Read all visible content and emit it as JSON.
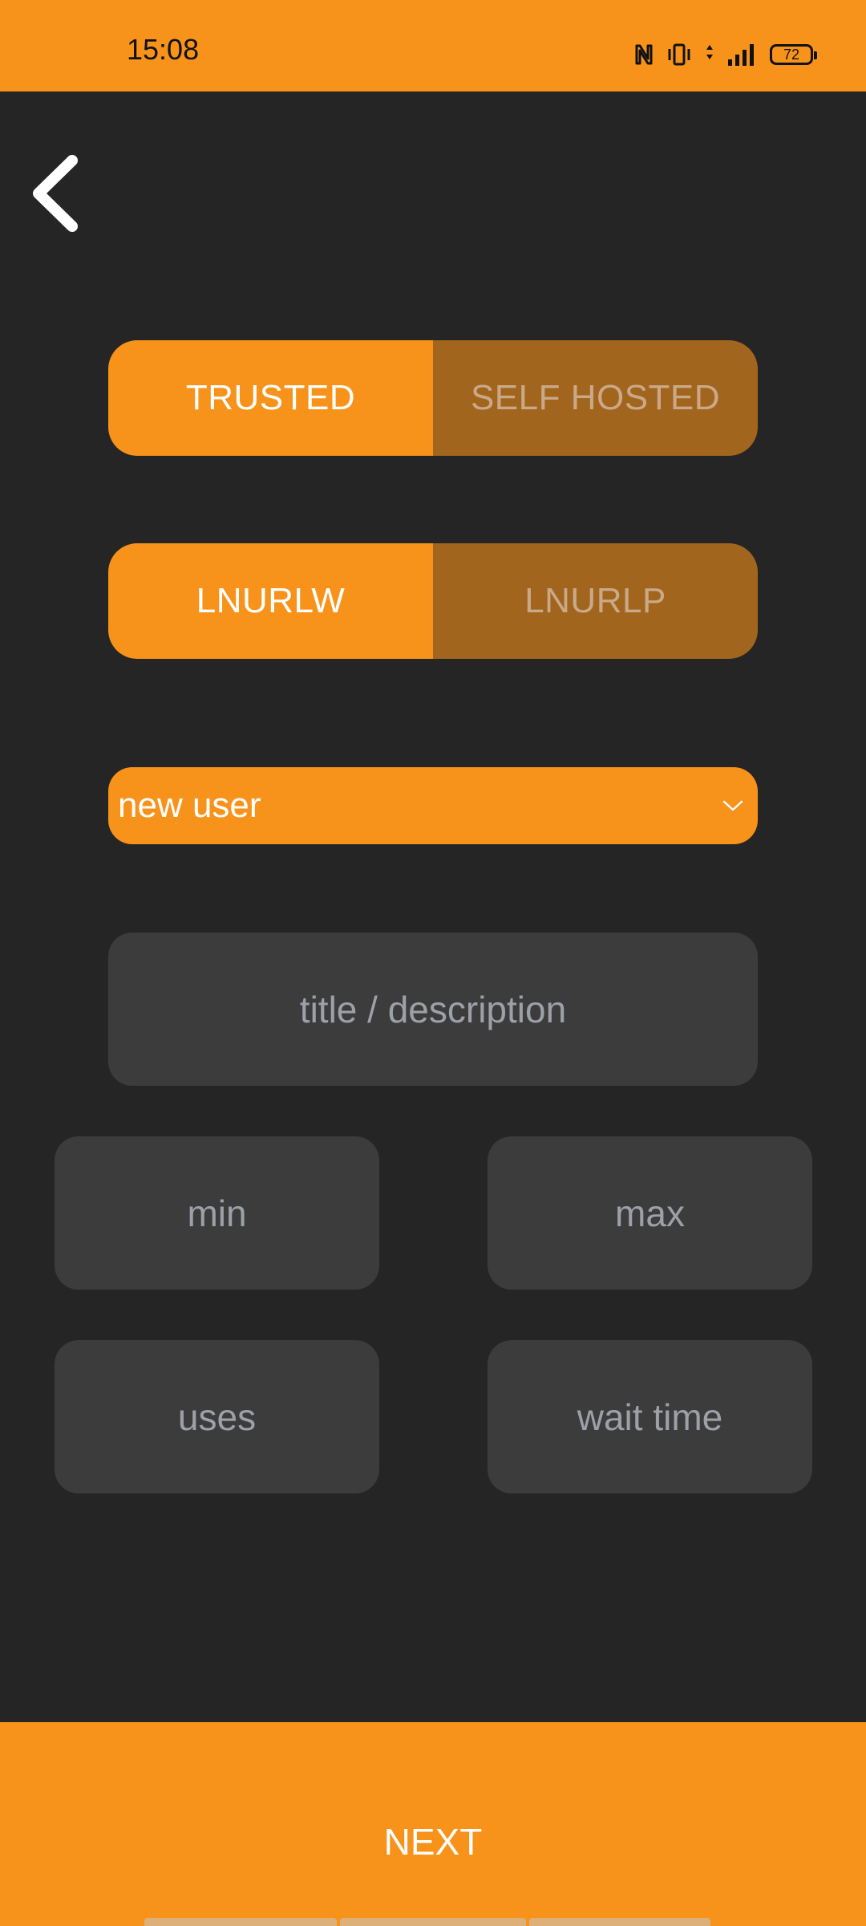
{
  "status_bar": {
    "time": "15:08",
    "battery": "72",
    "icons": [
      "nfc-icon",
      "vibrate-icon",
      "data-arrows-icon",
      "signal-icon",
      "battery-icon"
    ]
  },
  "back": {
    "icon": "chevron-left-icon"
  },
  "host_toggle": {
    "options": [
      "TRUSTED",
      "SELF HOSTED"
    ],
    "selected": "TRUSTED"
  },
  "lnurl_toggle": {
    "options": [
      "LNURLW",
      "LNURLP"
    ],
    "selected": "LNURLW"
  },
  "user_select": {
    "value": "new user",
    "icon": "chevron-down-icon"
  },
  "fields": {
    "title_placeholder": "title / description",
    "min_placeholder": "min",
    "max_placeholder": "max",
    "uses_placeholder": "uses",
    "wait_time_placeholder": "wait time"
  },
  "next_button": {
    "label": "NEXT"
  },
  "colors": {
    "accent": "#F7931A",
    "accent_inactive": "#A2651E",
    "background": "#252525",
    "field": "#3C3C3C",
    "placeholder": "#9EA0A8"
  }
}
